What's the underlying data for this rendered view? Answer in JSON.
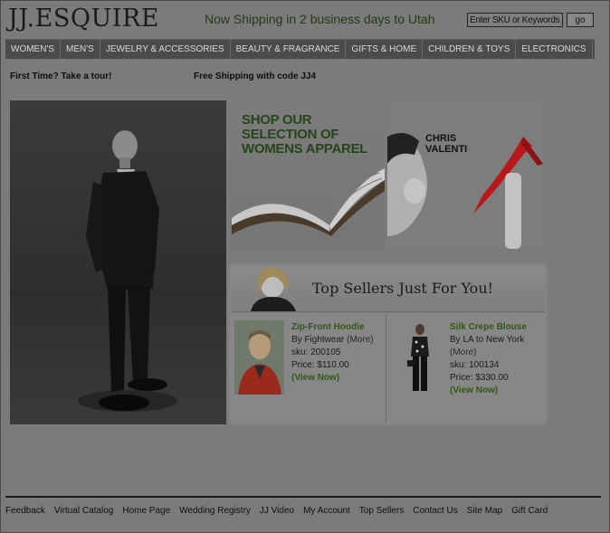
{
  "header": {
    "logo_text": "JJ.ESQUIRE",
    "shipping_message": "Now Shipping in 2 business days to Utah",
    "search_placeholder": "Enter SKU or Keywords",
    "go_label": "go"
  },
  "nav": {
    "items": [
      {
        "label": "WOMEN'S"
      },
      {
        "label": "MEN'S"
      },
      {
        "label": "JEWELRY & ACCESSORIES"
      },
      {
        "label": "BEAUTY & FRAGRANCE"
      },
      {
        "label": "GIFTS & HOME"
      },
      {
        "label": "CHILDREN & TOYS"
      },
      {
        "label": "ELECTRONICS"
      }
    ]
  },
  "promos": {
    "tour": "First Time?  Take a tour!",
    "free_shipping": "Free Shipping with code JJ4"
  },
  "banners": {
    "womens_line1": "SHOP OUR",
    "womens_line2": "SELECTION OF",
    "womens_line3": "WOMENS APPAREL",
    "designer_line1": "CHRIS",
    "designer_line2": "VALENTI"
  },
  "top_sellers": {
    "title": "Top Sellers Just For You!",
    "products": [
      {
        "name": "Zip-Front Hoodie",
        "by_prefix": "By ",
        "brand": "Fightwear",
        "more": "(More)",
        "sku": "sku: 200105",
        "price": "Price: $110.00",
        "view": "(View Now)"
      },
      {
        "name": "Silk Crepe Blouse",
        "by_prefix": "By ",
        "brand": "LA to New York",
        "more": "(More)",
        "sku": "sku: 100134",
        "price": "Price: $330.00",
        "view": "(View Now)"
      }
    ]
  },
  "footer": {
    "links": [
      {
        "label": "Feedback"
      },
      {
        "label": "Virtual Catalog"
      },
      {
        "label": "Home Page"
      },
      {
        "label": "Wedding Registry"
      },
      {
        "label": "JJ Video"
      },
      {
        "label": "My Account"
      },
      {
        "label": "Top Sellers"
      },
      {
        "label": "Contact Us"
      },
      {
        "label": "Site Map"
      },
      {
        "label": "Gift Card"
      }
    ]
  },
  "colors": {
    "background": "#7b7b7b",
    "accent_green": "#2d5a10",
    "nav_bar": "#4b4b4b"
  }
}
